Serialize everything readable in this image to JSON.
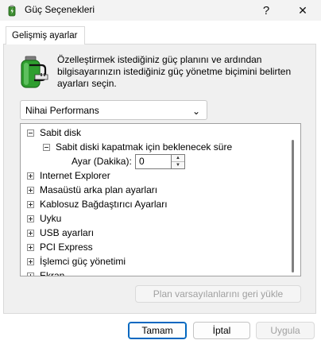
{
  "window": {
    "title": "Güç Seçenekleri",
    "help_label": "?",
    "close_label": "✕"
  },
  "tabs": [
    {
      "label": "Gelişmiş ayarlar",
      "selected": true
    }
  ],
  "description": "Özelleştirmek istediğiniz güç planını ve ardından bilgisayarınızın istediğiniz güç yönetme biçimini belirten ayarları seçin.",
  "plan_select": {
    "value": "Nihai Performans",
    "chevron": "⌄"
  },
  "tree": {
    "items": [
      {
        "label": "Sabit disk",
        "expanded": true
      },
      {
        "label": "Sabit diski kapatmak için beklenecek süre",
        "expanded": true
      },
      {
        "label": "Ayar (Dakika):",
        "value": "0"
      },
      {
        "label": "Internet Explorer",
        "expanded": false
      },
      {
        "label": "Masaüstü arka plan ayarları",
        "expanded": false
      },
      {
        "label": "Kablosuz Bağdaştırıcı Ayarları",
        "expanded": false
      },
      {
        "label": "Uyku",
        "expanded": false
      },
      {
        "label": "USB ayarları",
        "expanded": false
      },
      {
        "label": "PCI Express",
        "expanded": false
      },
      {
        "label": "İşlemci güç yönetimi",
        "expanded": false
      },
      {
        "label": "Ekran",
        "expanded": false
      }
    ],
    "spin_up": "▲",
    "spin_down": "▼"
  },
  "buttons": {
    "restore_defaults": "Plan varsayılanlarını geri yükle",
    "ok": "Tamam",
    "cancel": "İptal",
    "apply": "Uygula"
  },
  "colors": {
    "accent": "#0067c0",
    "battery_green": "#2e9e2e"
  },
  "icons": [
    "battery-power-icon",
    "help-icon",
    "close-icon",
    "chevron-down-icon",
    "collapse-icon",
    "expand-icon"
  ]
}
